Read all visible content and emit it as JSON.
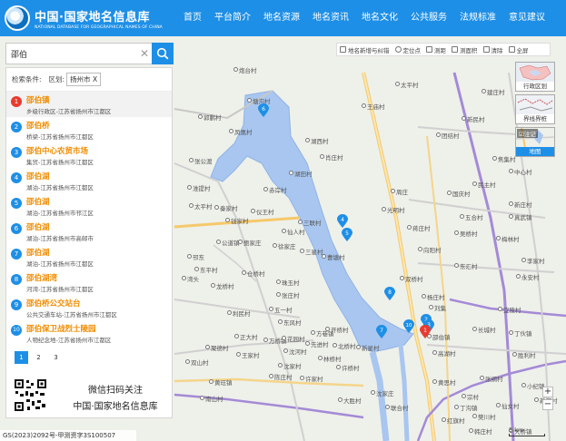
{
  "site": {
    "title": "中国·国家地名信息库",
    "subtitle": "NATIONAL DATABASE FOR GEOGRAPHICAL NAMES OF CHINA"
  },
  "nav": [
    "首页",
    "平台简介",
    "地名资源",
    "地名资讯",
    "地名文化",
    "公共服务",
    "法规标准",
    "意见建议"
  ],
  "search": {
    "value": "邵伯"
  },
  "conditions": {
    "label": "检索条件:",
    "region_label": "区划:",
    "region_value": "扬州市 X"
  },
  "results": [
    {
      "num": "1",
      "title": "邵伯镇",
      "desc": "乡级行政区-江苏省扬州市江都区"
    },
    {
      "num": "2",
      "title": "邵伯桥",
      "desc": "桥梁-江苏省扬州市江都区"
    },
    {
      "num": "3",
      "title": "邵伯中心农贸市场",
      "desc": "集贸-江苏省扬州市江都区"
    },
    {
      "num": "4",
      "title": "邵伯湖",
      "desc": "湖泊-江苏省扬州市江都区"
    },
    {
      "num": "5",
      "title": "邵伯湖",
      "desc": "湖泊-江苏省扬州市邗江区"
    },
    {
      "num": "6",
      "title": "邵伯湖",
      "desc": "湖泊-江苏省扬州市高邮市"
    },
    {
      "num": "7",
      "title": "邵伯湖",
      "desc": "湖泊-江苏省扬州市江都区"
    },
    {
      "num": "8",
      "title": "邵伯湖湾",
      "desc": "河湾-江苏省扬州市江都区"
    },
    {
      "num": "9",
      "title": "邵伯桥公交站台",
      "desc": "公共交通车站-江苏省扬州市江都区"
    },
    {
      "num": "10",
      "title": "邵伯保卫战烈士陵园",
      "desc": "人物纪念地-江苏省扬州市江都区"
    }
  ],
  "pager": [
    "1",
    "2",
    "3"
  ],
  "qr": {
    "line1": "微信扫码关注",
    "line2": "中国·国家地名信息库"
  },
  "toolbar": [
    "地名新增与纠错",
    "定位点",
    "测距",
    "测面积",
    "清除",
    "全屏"
  ],
  "layers": {
    "admin": "行政区划",
    "boundary": "界线界桩",
    "check": "注记",
    "map": "地图"
  },
  "zoom": {
    "in": "+",
    "out": "−"
  },
  "scale": "5 km",
  "footer": "GS(2023)2092号-甲测资字3S100507",
  "map_labels": [
    "炮台村",
    "太平村",
    "建庄村",
    "塘沟村",
    "王庙村",
    "新民村",
    "湖西村",
    "团结村",
    "郭鹏村",
    "凤凰村",
    "张公渡",
    "肖庄村",
    "淮提村",
    "赤岸村",
    "湖田村",
    "国庆村",
    "太平村",
    "秦家村",
    "钱家村",
    "仪王村",
    "仙人村",
    "三联村",
    "公道镇",
    "鲍家庄",
    "徐家庄",
    "邗东",
    "曹塘村",
    "东平村",
    "仓桥村",
    "珠玉村",
    "湾头",
    "龙桥村",
    "张庄村",
    "利民村",
    "五一村",
    "东风村",
    "正大村",
    "万桥镇",
    "方巷镇",
    "聚德村",
    "双山村",
    "王家村",
    "沈河村",
    "林桥村",
    "沈家村",
    "三星村",
    "先进村",
    "开桥村",
    "花园村",
    "北桥村",
    "黄珏镇",
    "许桥村",
    "南山村",
    "陈庄村",
    "许家村",
    "高湖村",
    "沈家庄",
    "大胜村",
    "联合村",
    "杨庄村",
    "新星村",
    "向阳村",
    "刘集",
    "焦集村",
    "中心村",
    "民主村",
    "周庄",
    "新庄村",
    "光明村",
    "五合村",
    "梅林村",
    "真武镇",
    "蒋庄村",
    "吴桥村",
    "李家村",
    "永安村",
    "丁伙镇",
    "小纪镇",
    "东汇村",
    "双桥村",
    "宜陵村",
    "长城村",
    "胜利村",
    "张纲村",
    "宗村",
    "仙女村",
    "樊川村",
    "新河村",
    "红旗村",
    "邵伯镇",
    "黄思村",
    "大桥镇",
    "韩庄村",
    "丁沟镇"
  ]
}
